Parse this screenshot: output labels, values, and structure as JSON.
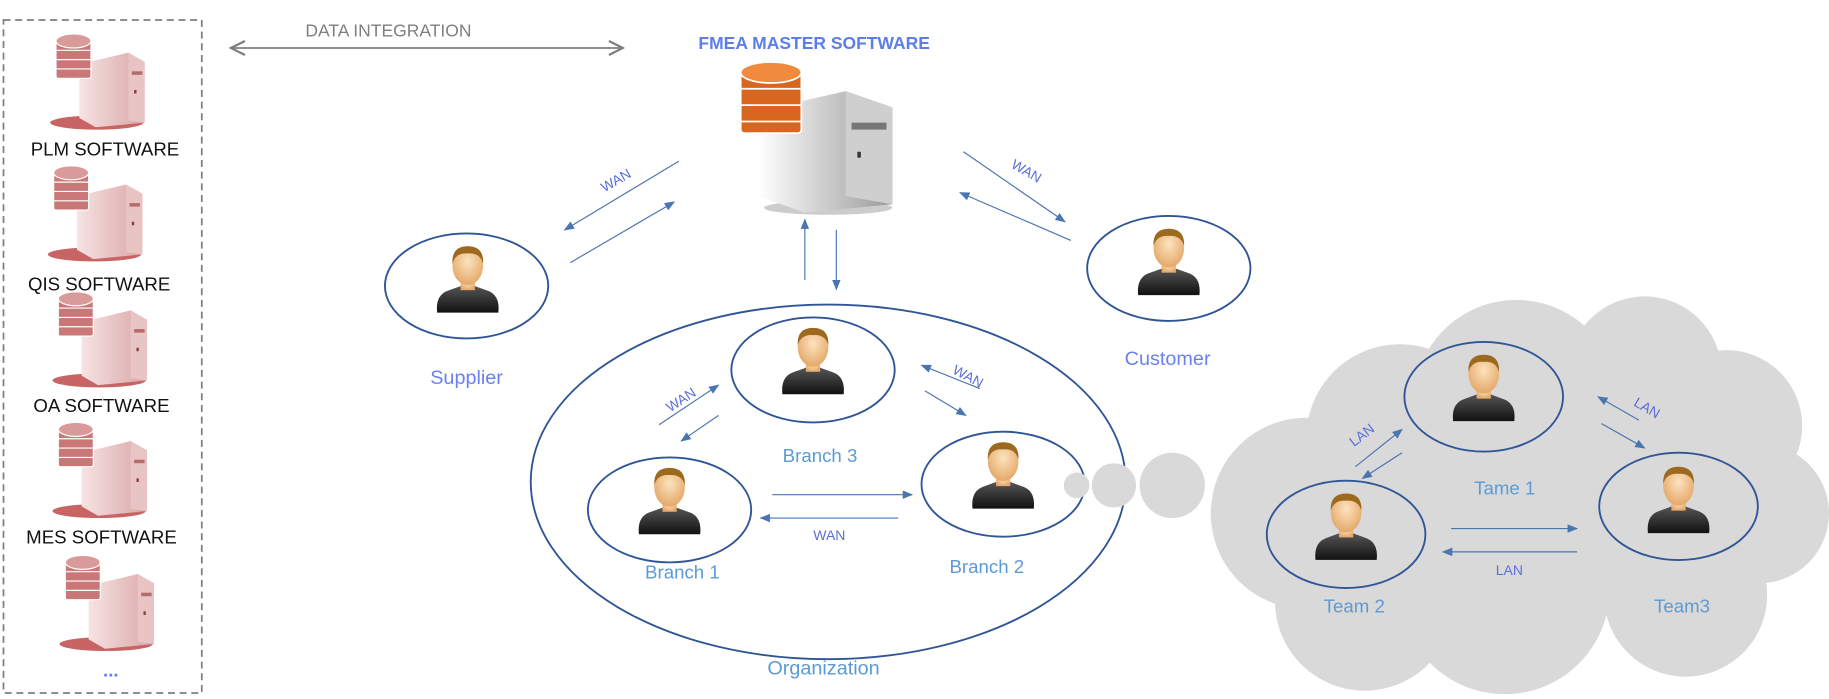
{
  "integration": {
    "label": "DATA INTEGRATION",
    "color": "#7f7f7f"
  },
  "external_systems": [
    {
      "label": "PLM SOFTWARE",
      "icon": "red-database-server-icon"
    },
    {
      "label": "QIS SOFTWARE",
      "icon": "red-database-server-icon"
    },
    {
      "label": "OA SOFTWARE",
      "icon": "red-database-server-icon"
    },
    {
      "label": "MES SOFTWARE",
      "icon": "red-database-server-icon"
    },
    {
      "label": "...",
      "icon": "red-database-server-icon"
    }
  ],
  "master": {
    "title": "FMEA MASTER SOFTWARE",
    "icon": "orange-database-server-icon",
    "color": "#5b7ee8"
  },
  "parties": {
    "supplier": "Supplier",
    "customer": "Customer"
  },
  "organization": {
    "label": "Organization",
    "branches": [
      "Branch 1",
      "Branch 2",
      "Branch 3"
    ]
  },
  "teams": [
    "Tame 1",
    "Team 2",
    "Team3"
  ],
  "links": {
    "wan": "WAN",
    "lan": "LAN"
  },
  "colors": {
    "node_stroke": "#2f5597",
    "arrow": "#4a76b0",
    "cloud": "#d9d9d9",
    "node_label": "#5b9bd5"
  }
}
